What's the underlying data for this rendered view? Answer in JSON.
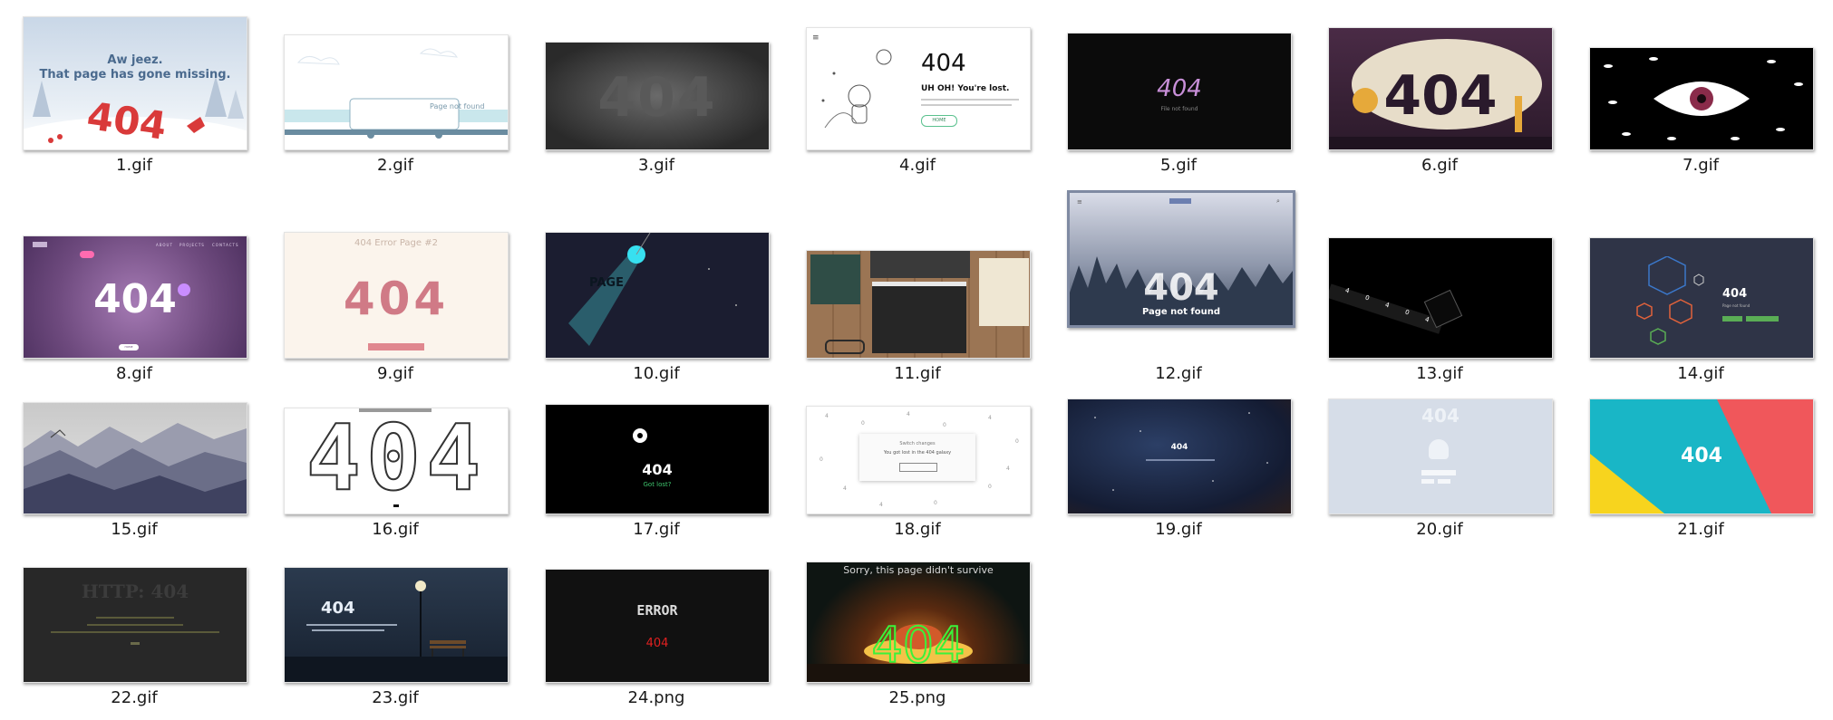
{
  "files": [
    {
      "name": "1.gif",
      "thumb": {
        "headline": "Aw jeez.",
        "subline": "That page has gone missing.",
        "code": "404"
      }
    },
    {
      "name": "2.gif",
      "thumb": {
        "text": "Page not found"
      }
    },
    {
      "name": "3.gif",
      "thumb": {
        "code": "404"
      }
    },
    {
      "name": "4.gif",
      "thumb": {
        "code": "404",
        "title": "UH OH! You're lost.",
        "button": "HOME"
      }
    },
    {
      "name": "5.gif",
      "thumb": {
        "code": "404",
        "subtitle": "File not found"
      }
    },
    {
      "name": "6.gif",
      "thumb": {
        "code": "404"
      }
    },
    {
      "name": "7.gif",
      "thumb": {}
    },
    {
      "name": "8.gif",
      "thumb": {
        "code": "404",
        "nav": [
          "ABOUT",
          "PROJECTS",
          "CONTACTS"
        ],
        "button": "HOME"
      }
    },
    {
      "name": "9.gif",
      "thumb": {
        "title": "404 Error Page #2",
        "code": "404"
      }
    },
    {
      "name": "10.gif",
      "thumb": {
        "text": "PAGE"
      }
    },
    {
      "name": "11.gif",
      "thumb": {}
    },
    {
      "name": "12.gif",
      "thumb": {
        "code": "404",
        "title": "Page not found"
      }
    },
    {
      "name": "13.gif",
      "thumb": {
        "digits": [
          "4",
          "0",
          "4",
          "0",
          "4"
        ]
      }
    },
    {
      "name": "14.gif",
      "thumb": {
        "code": "404",
        "subtitle": "Page not found"
      }
    },
    {
      "name": "15.gif",
      "thumb": {}
    },
    {
      "name": "16.gif",
      "thumb": {
        "code": "404"
      }
    },
    {
      "name": "17.gif",
      "thumb": {
        "code": "404",
        "subtitle": "Got lost?"
      }
    },
    {
      "name": "18.gif",
      "thumb": {
        "title": "Switch changes",
        "line": "You got lost in the 404 galaxy"
      }
    },
    {
      "name": "19.gif",
      "thumb": {
        "code": "404"
      }
    },
    {
      "name": "20.gif",
      "thumb": {
        "code": "404"
      }
    },
    {
      "name": "21.gif",
      "thumb": {
        "code": "404"
      }
    },
    {
      "name": "22.gif",
      "thumb": {
        "code": "HTTP: 404"
      }
    },
    {
      "name": "23.gif",
      "thumb": {
        "code": "404"
      }
    },
    {
      "name": "24.png",
      "thumb": {
        "title": "ERROR",
        "code": "404"
      }
    },
    {
      "name": "25.png",
      "thumb": {
        "title": "Sorry, this page didn't survive",
        "code": "404"
      }
    }
  ]
}
